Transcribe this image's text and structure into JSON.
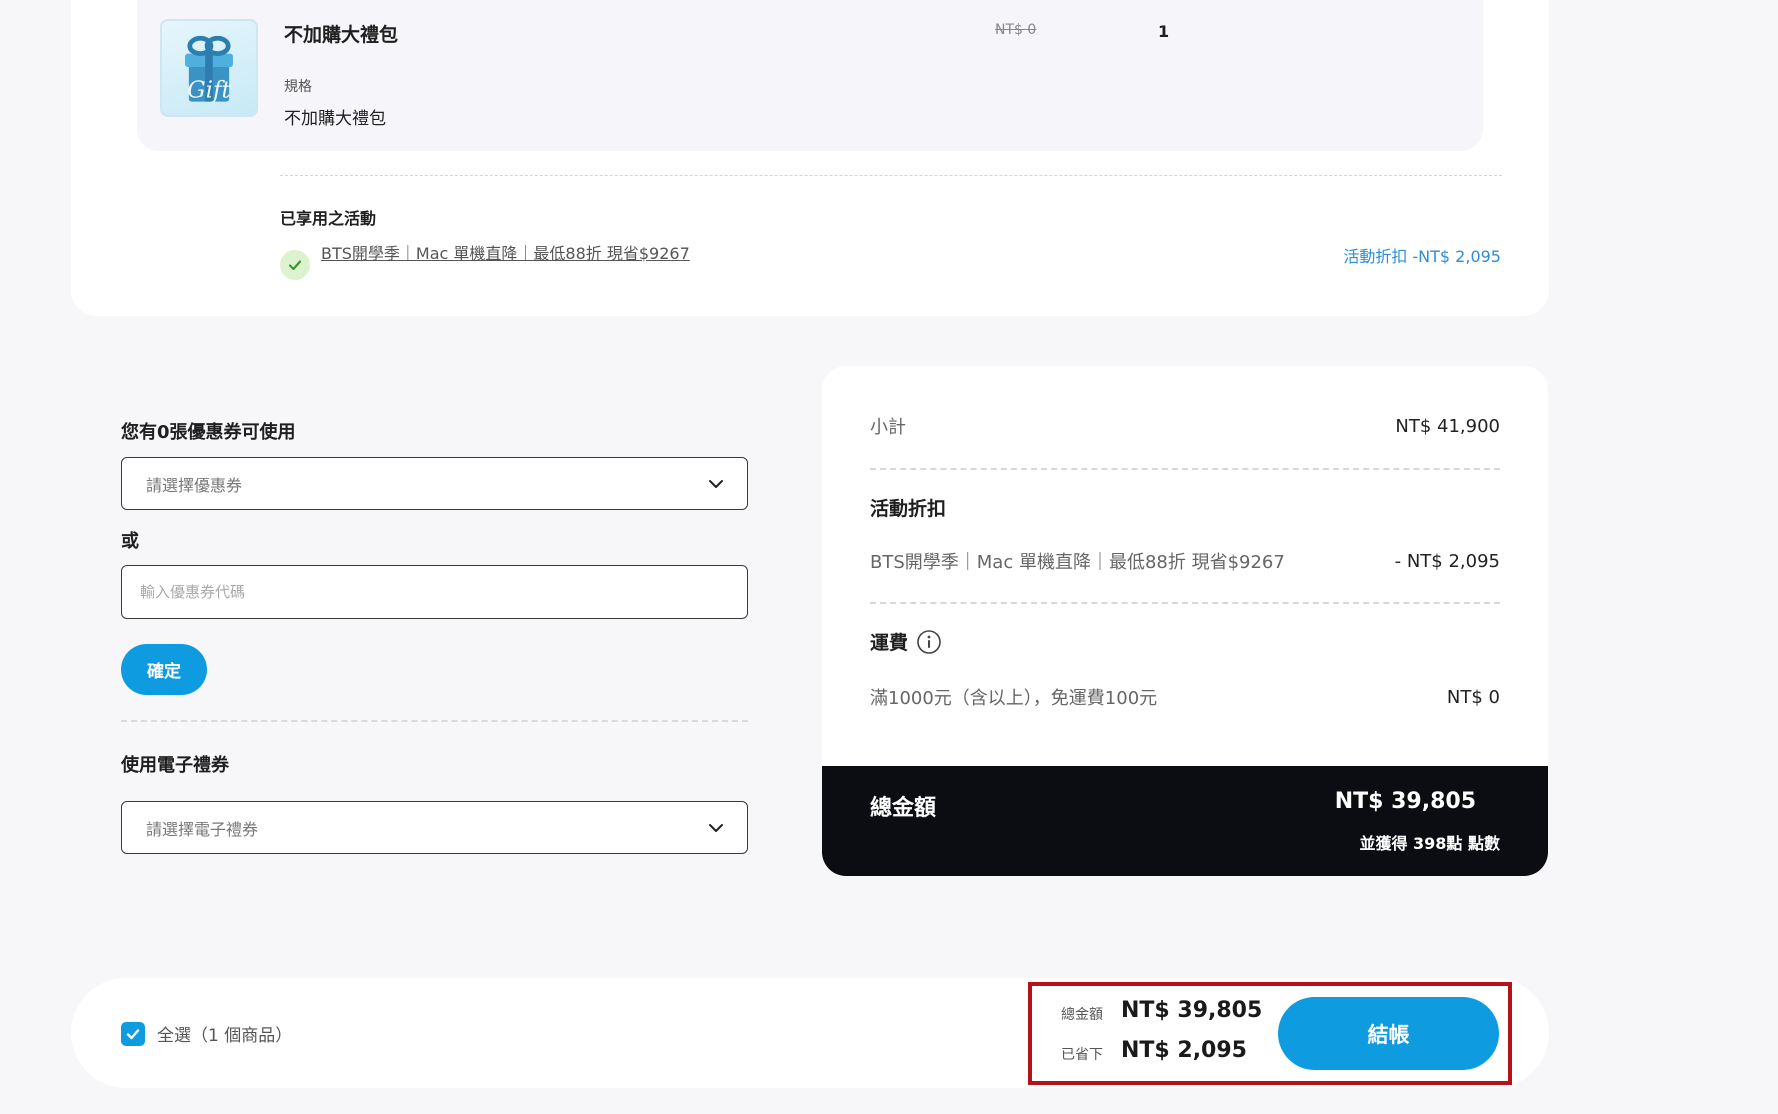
{
  "cart_item": {
    "name": "不加購大禮包",
    "spec_label": "規格",
    "spec_value": "不加購大禮包",
    "price": "NT$ 0",
    "quantity": "1",
    "thumbnail_icon": "gift-box-icon",
    "thumbnail_text": "Gift"
  },
  "applied_promos": {
    "title": "已享用之活動",
    "promo_link": "BTS開學季｜Mac 單機直降｜最低88折 現省$9267",
    "discount_text": "活動折扣 -NT$ 2,095"
  },
  "coupons": {
    "title": "您有0張優惠券可使用",
    "select_placeholder": "請選擇優惠券",
    "or_label": "或",
    "code_placeholder": "輸入優惠券代碼",
    "confirm_label": "確定"
  },
  "evoucher": {
    "title": "使用電子禮券",
    "select_placeholder": "請選擇電子禮券"
  },
  "summary": {
    "subtotal_label": "小計",
    "subtotal_value": "NT$ 41,900",
    "discount_heading": "活動折扣",
    "discount_desc": "BTS開學季｜Mac 單機直降｜最低88折 現省$9267",
    "discount_value": "- NT$ 2,095",
    "shipping_heading": "運費",
    "shipping_desc": "滿1000元（含以上），免運費100元",
    "shipping_value": "NT$ 0",
    "total_label": "總金額",
    "total_value": "NT$ 39,805",
    "points_text": "並獲得 398點 點數"
  },
  "bottom_bar": {
    "select_all_label": "全選（1 個商品）",
    "select_all_checked": true,
    "total_label": "總金額",
    "total_value": "NT$ 39,805",
    "saved_label": "已省下",
    "saved_value": "NT$ 2,095",
    "checkout_label": "結帳"
  },
  "colors": {
    "accent": "#0f9be0",
    "highlight_border": "#b5121b",
    "total_bar_bg": "#0b0d12",
    "promo_discount": "#2b8fd6"
  }
}
